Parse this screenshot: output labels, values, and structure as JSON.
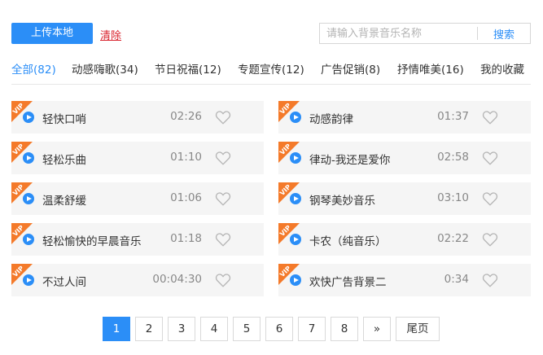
{
  "toolbar": {
    "upload_label": "上传本地",
    "clear_label": "清除",
    "search_placeholder": "请输入背景音乐名称",
    "search_button": "搜索"
  },
  "tabs": [
    {
      "label": "全部(82)",
      "active": true
    },
    {
      "label": "动感嗨歌(34)",
      "active": false
    },
    {
      "label": "节日祝福(12)",
      "active": false
    },
    {
      "label": "专题宣传(12)",
      "active": false
    },
    {
      "label": "广告促销(8)",
      "active": false
    },
    {
      "label": "抒情唯美(16)",
      "active": false
    },
    {
      "label": "我的收藏",
      "active": false
    }
  ],
  "songs": [
    {
      "title": "轻快口哨",
      "duration": "02:26",
      "vip": "VIP"
    },
    {
      "title": "动感韵律",
      "duration": "01:37",
      "vip": "VIP"
    },
    {
      "title": "轻松乐曲",
      "duration": "01:10",
      "vip": "VIP"
    },
    {
      "title": "律动-我还是爱你",
      "duration": "02:58",
      "vip": "VIP"
    },
    {
      "title": "温柔舒缓",
      "duration": "01:06",
      "vip": "VIP"
    },
    {
      "title": "钢琴美妙音乐",
      "duration": "03:10",
      "vip": "VIP"
    },
    {
      "title": "轻松愉快的早晨音乐",
      "duration": "01:18",
      "vip": "VIP"
    },
    {
      "title": "卡农（纯音乐）",
      "duration": "02:22",
      "vip": "VIP"
    },
    {
      "title": "不过人间",
      "duration": "00:04:30",
      "vip": "VIP"
    },
    {
      "title": "欢快广告背景二",
      "duration": "0:34",
      "vip": "VIP"
    }
  ],
  "pagination": {
    "pages": [
      "1",
      "2",
      "3",
      "4",
      "5",
      "6",
      "7",
      "8"
    ],
    "current": "1",
    "next_label": "»",
    "last_label": "尾页"
  },
  "colors": {
    "accent": "#2b8ef7",
    "vip_badge": "#f47a2a",
    "clear_link": "#d9232d",
    "row_bg": "#f5f5f5"
  }
}
